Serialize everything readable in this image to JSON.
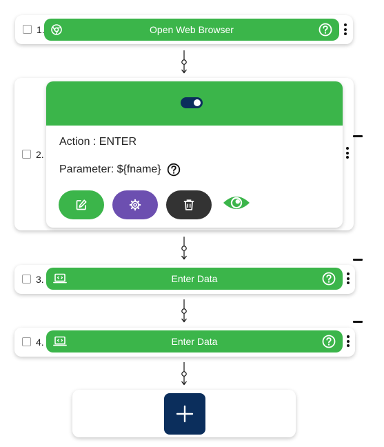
{
  "steps": [
    {
      "number": "1.",
      "label": "Open Web Browser",
      "icon": "chrome-icon"
    },
    {
      "number": "2.",
      "toggle_on": true,
      "action_label": "Action : ENTER",
      "parameter_label": "Parameter: ${fname}"
    },
    {
      "number": "3.",
      "label": "Enter Data",
      "icon": "laptop-code-icon"
    },
    {
      "number": "4.",
      "label": "Enter Data",
      "icon": "laptop-code-icon"
    }
  ],
  "actions": {
    "edit": "edit-icon",
    "settings": "gear-icon",
    "delete": "trash-icon",
    "view": "eye-icon"
  },
  "colors": {
    "green": "#3bb54a",
    "purple": "#6c4fb0",
    "dark": "#333333",
    "navy": "#0b2e5c"
  }
}
